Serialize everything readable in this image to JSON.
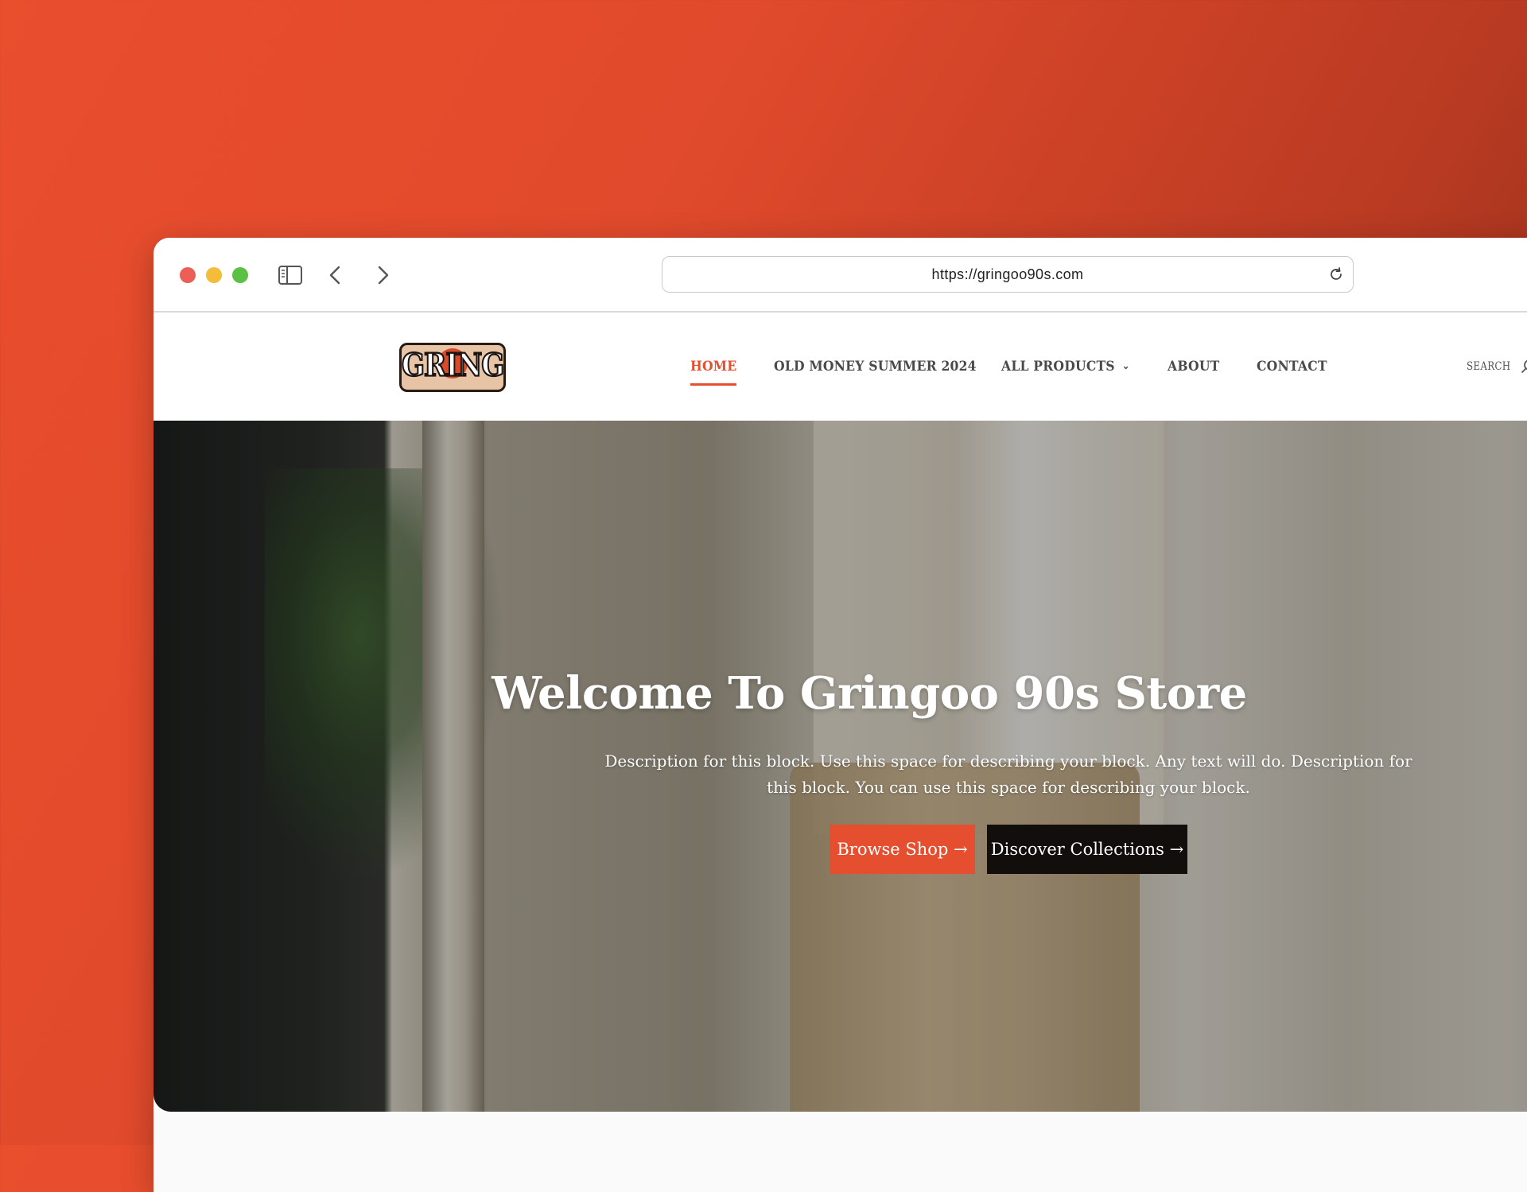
{
  "browser": {
    "url": "https://gringoo90s.com",
    "traffic_lights": [
      "#ec5f56",
      "#f3bd3b",
      "#5ac144"
    ]
  },
  "site": {
    "logo_text": "GRINGO",
    "nav": [
      {
        "label": "HOME",
        "active": true
      },
      {
        "label": "OLD MONEY SUMMER 2024",
        "active": false
      },
      {
        "label": "ALL PRODUCTS",
        "active": false,
        "has_dropdown": true
      },
      {
        "label": "ABOUT",
        "active": false
      },
      {
        "label": "CONTACT",
        "active": false
      }
    ],
    "search_label": "SEARCH",
    "accent": "#e54e2f"
  },
  "hero": {
    "title": "Welcome To Gringoo 90s Store",
    "description": "Description for this block. Use this space for describing your block. Any text will do. Description for this block. You can use this space for describing your block.",
    "primary_button": "Browse Shop →",
    "secondary_button": "Discover Collections →"
  }
}
